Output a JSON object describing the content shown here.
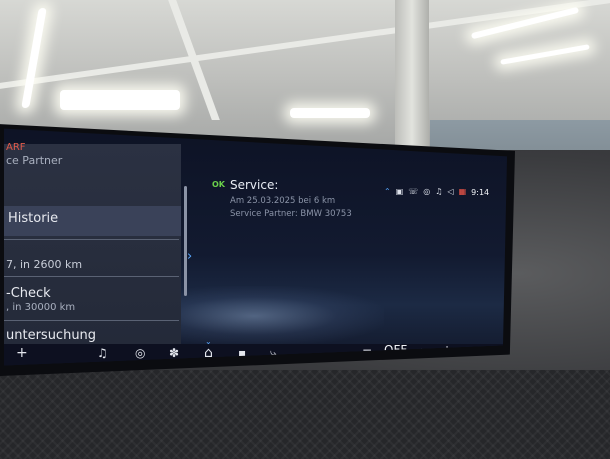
{
  "left_panel": {
    "header_top": "ARF",
    "header_sub": "ce Partner",
    "items": [
      {
        "label": "Historie",
        "selected": true
      },
      {
        "label": "7, in 2600 km"
      },
      {
        "label": "-Check",
        "sub": ", in 30000 km"
      },
      {
        "label": "untersuchung"
      }
    ]
  },
  "message": {
    "status": "OK",
    "title": "Service:",
    "lines": [
      "Am 25.03.2025 bei 6 km",
      "Service Partner: BMW 30753"
    ]
  },
  "status_bar": {
    "icons": [
      "chevron-up-icon",
      "notification-icon",
      "phone-icon",
      "connectivity-icon",
      "music-icon",
      "volume-icon",
      "calendar-icon"
    ],
    "time": "9:14"
  },
  "dock": {
    "items": [
      "music-icon",
      "navigation-icon",
      "fan-icon",
      "home-icon",
      "apps-icon",
      "phone-icon"
    ],
    "left_plus": "+"
  },
  "climate": {
    "minus": "−",
    "fan_state": "OFF",
    "plus": "+"
  },
  "colors": {
    "accent_blue": "#3d87ff",
    "ok_green": "#6ad04a",
    "alert_red": "#e0332f"
  }
}
